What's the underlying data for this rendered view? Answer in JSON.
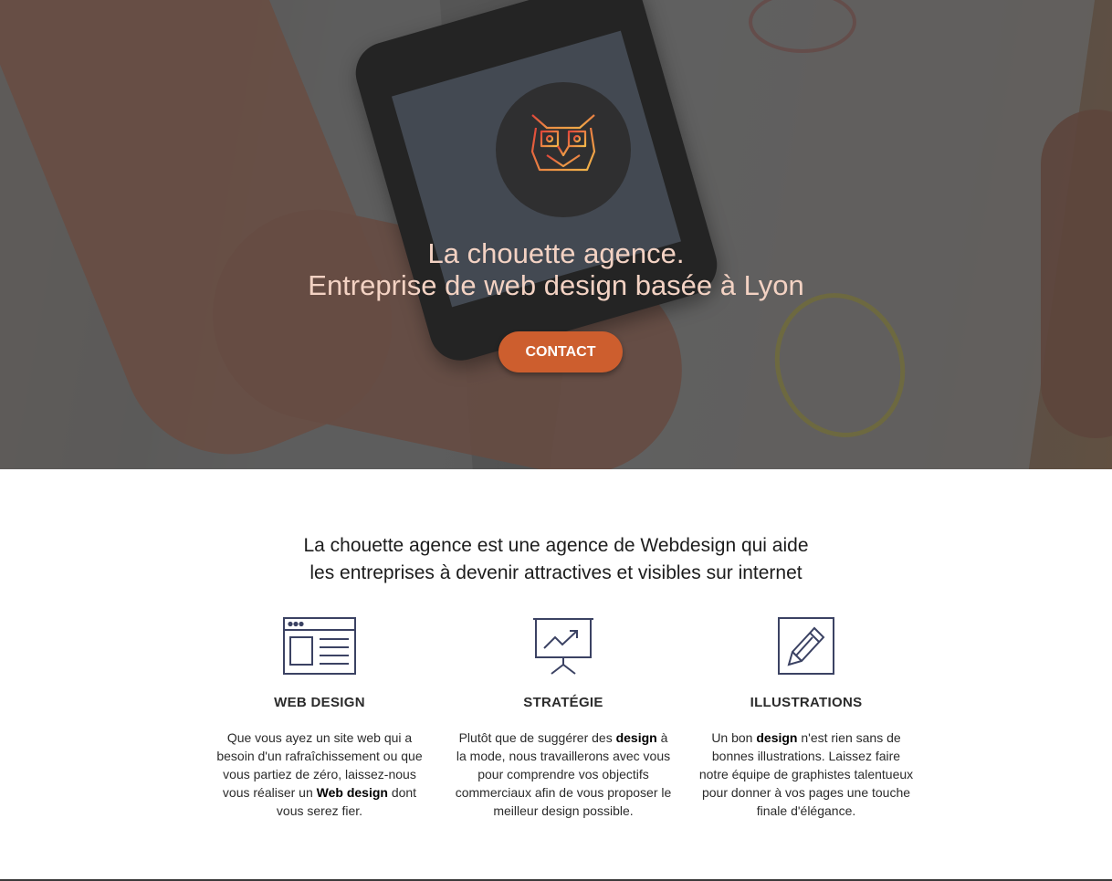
{
  "hero": {
    "title_line1": "La chouette agence.",
    "title_line2": "Entreprise de web design basée à Lyon",
    "contact_label": "CONTACT",
    "logo_icon": "owl-logo-icon",
    "accent_color": "#cd5e2e",
    "title_color": "#f3d2c3"
  },
  "intro": {
    "line1": "La chouette agence est une agence de Webdesign qui aide",
    "line2": "les entreprises à devenir attractives et visibles sur internet"
  },
  "services": [
    {
      "icon": "browser-window-icon",
      "title": "WEB DESIGN",
      "desc_before": "Que vous ayez un site web qui a besoin d'un rafraîchissement ou que vous partiez de zéro, laissez-nous vous réaliser un ",
      "desc_bold": "Web design",
      "desc_after": " dont vous serez fier."
    },
    {
      "icon": "presentation-chart-icon",
      "title": "STRATÉGIE",
      "desc_before": "Plutôt que de suggérer des ",
      "desc_bold": "design",
      "desc_after": " à la mode, nous travaillerons avec vous pour comprendre vos objectifs commerciaux afin de vous proposer le meilleur design possible."
    },
    {
      "icon": "pencil-square-icon",
      "title": "ILLUSTRATIONS",
      "desc_before": "Un bon ",
      "desc_bold": "design",
      "desc_after": " n'est rien sans de bonnes illustrations. Laissez faire notre équipe de graphistes talentueux pour donner à vos pages une touche finale d'élégance."
    }
  ]
}
